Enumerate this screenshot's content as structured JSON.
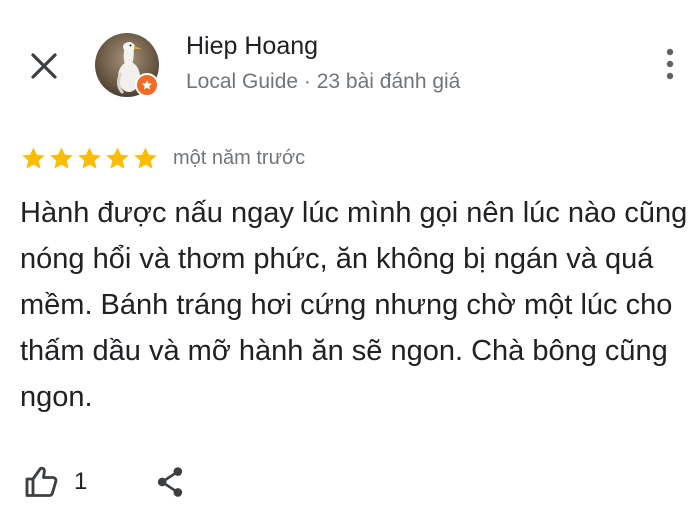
{
  "header": {
    "close_icon": "close-icon",
    "more_icon": "more-vert-icon"
  },
  "author": {
    "name": "Hiep Hoang",
    "meta": "Local Guide · 23 bài đánh giá",
    "badge_icon": "local-guide-star-icon",
    "badge_color": "#f06b27"
  },
  "review": {
    "rating": 5,
    "rating_max": 5,
    "star_color": "#fbbc04",
    "date": "một năm trước",
    "text": "Hành được nấu ngay lúc mình gọi nên lúc nào cũng nóng hổi và thơm phức, ăn không bị ngán và quá mềm. Bánh tráng hơi cứng nhưng chờ một lúc cho thấm dầu và mỡ hành ăn sẽ ngon. Chà bông cũng ngon."
  },
  "actions": {
    "like_icon": "thumb-up-icon",
    "like_count": "1",
    "share_icon": "share-icon"
  }
}
